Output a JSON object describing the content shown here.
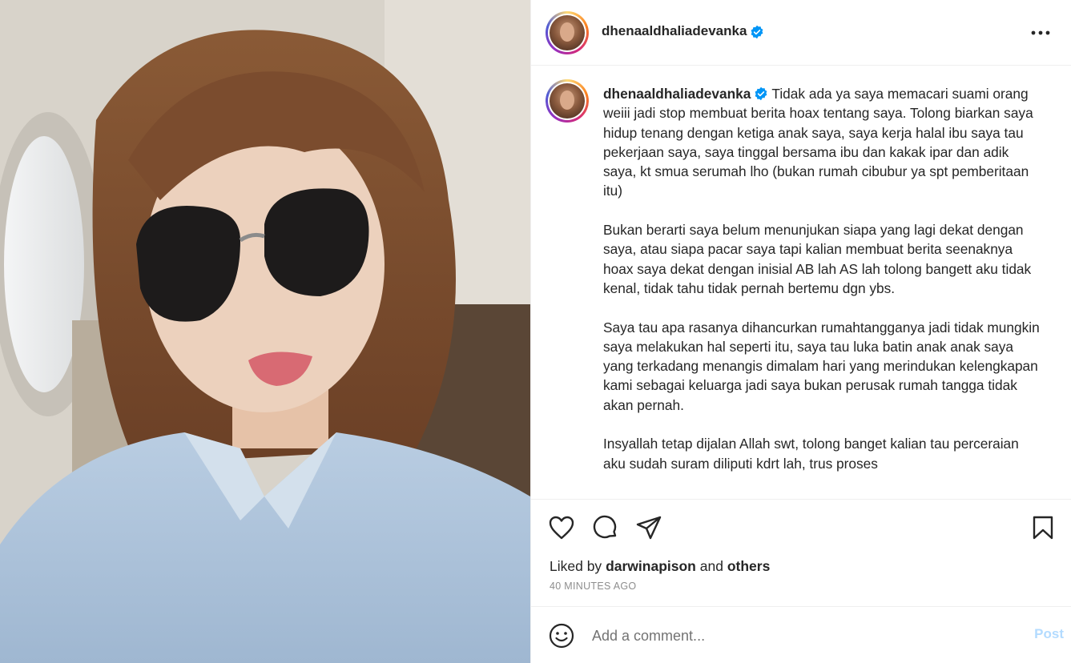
{
  "post": {
    "username": "dhenaaldhaliadevanka",
    "caption_paragraphs": [
      "Tidak ada ya saya memacari suami orang weiii jadi stop membuat berita hoax tentang saya. Tolong biarkan saya hidup tenang dengan ketiga anak saya, saya kerja halal ibu saya tau pekerjaan saya, saya tinggal bersama ibu dan kakak ipar dan adik saya, kt smua serumah lho (bukan rumah cibubur ya spt pemberitaan itu)",
      "Bukan berarti saya belum menunjukan siapa yang lagi dekat dengan saya, atau siapa pacar saya tapi kalian membuat berita seenaknya hoax saya dekat dengan inisial AB lah AS lah tolong bangett aku tidak kenal, tidak tahu tidak pernah bertemu dgn ybs.",
      "Saya tau apa rasanya dihancurkan rumahtangganya jadi tidak mungkin saya melakukan hal seperti itu, saya tau luka batin anak anak saya yang terkadang menangis dimalam hari yang merindukan kelengkapan kami sebagai keluarga jadi saya bukan perusak rumah tangga tidak akan pernah.",
      "Insyallah tetap dijalan Allah swt, tolong banget kalian tau perceraian aku sudah suram diliputi kdrt lah, trus proses"
    ],
    "liked_by_prefix": "Liked by",
    "liked_by_user": "darwinapison",
    "liked_by_and": "and",
    "liked_by_others": "others",
    "timestamp": "40 MINUTES AGO"
  },
  "comment": {
    "placeholder": "Add a comment...",
    "post_label": "Post"
  },
  "icons": {
    "verified": "verified-badge-icon",
    "more": "more-options-icon",
    "like": "heart-icon",
    "comment": "comment-bubble-icon",
    "share": "paper-plane-icon",
    "save": "bookmark-icon",
    "emoji": "smiley-icon"
  },
  "colors": {
    "verified_blue": "#0095f6",
    "post_disabled": "#b3dbff",
    "muted_text": "#8e8e8e"
  }
}
